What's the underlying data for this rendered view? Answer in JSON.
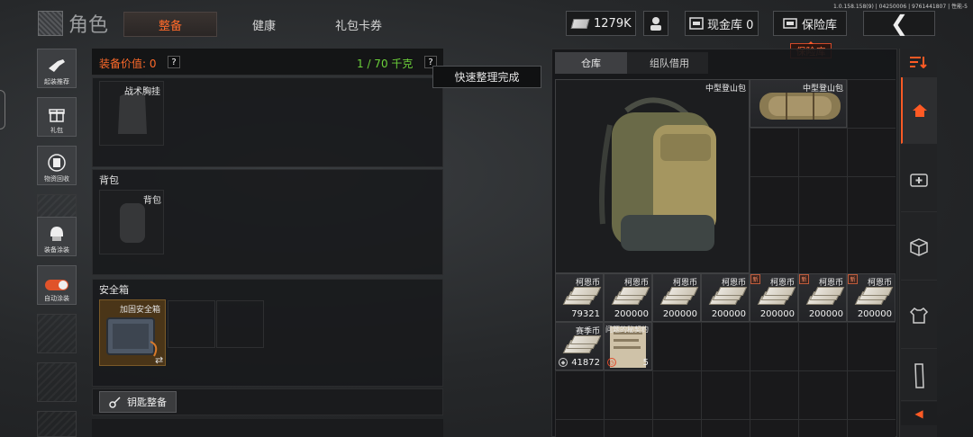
{
  "version": "1.0.158.158(9) | 04250006 | 9761441807 | 性能-5",
  "header": {
    "title": "角色",
    "tabs": [
      {
        "label": "整备",
        "active": true
      },
      {
        "label": "健康"
      },
      {
        "label": "礼包卡券"
      }
    ],
    "money": "1279K",
    "cash_vault": "现金库 0",
    "vault_label": "保险库",
    "vault_tooltip": "保险库",
    "back_icon": "chevron-left-icon"
  },
  "sidebar": {
    "items": [
      {
        "label": "起装推荐",
        "icon": "rifle-icon"
      },
      {
        "label": "礼包",
        "icon": "gift-icon"
      },
      {
        "label": "物资回收",
        "icon": "recycle-icon"
      },
      {
        "label": "装备涂装",
        "icon": "helmet-icon"
      },
      {
        "label": "自动涂装",
        "icon": "toggle-icon",
        "toggle_on": true
      }
    ]
  },
  "equipment": {
    "value_label": "装备价值: 0",
    "weight_label": "1 / 70 千克",
    "help": "?",
    "vest": {
      "slot_label": "战术胸挂"
    },
    "backpack": {
      "section_title": "背包",
      "slot_label": "背包"
    },
    "safe_box": {
      "section_title": "安全箱",
      "item_label": "加固安全箱",
      "swap_icon": "⇄"
    },
    "key_button": "钥匙整备"
  },
  "toast": "快速整理完成",
  "stash": {
    "tabs": [
      {
        "label": "仓库",
        "active": true
      },
      {
        "label": "组队借用"
      }
    ],
    "items": [
      {
        "name": "中型登山包",
        "qty": ""
      },
      {
        "name": "中型登山包",
        "qty": ""
      },
      {
        "name": "柯恩币",
        "qty": "79321",
        "new": false
      },
      {
        "name": "柯恩币",
        "qty": "200000",
        "new": false
      },
      {
        "name": "柯恩币",
        "qty": "200000",
        "new": false
      },
      {
        "name": "柯恩币",
        "qty": "200000",
        "new": false
      },
      {
        "name": "柯恩币",
        "qty": "200000",
        "new": true
      },
      {
        "name": "柯恩币",
        "qty": "200000",
        "new": true
      },
      {
        "name": "柯恩币",
        "qty": "200000",
        "new": true
      },
      {
        "name": "赛季币",
        "qty": "41872"
      },
      {
        "name": "问题的秘契约",
        "qty": "5"
      }
    ],
    "new_badge": "新"
  },
  "rail": {
    "items": [
      "sort-icon",
      "home-icon",
      "medkit-icon",
      "box-icon",
      "armor-icon",
      "magazine-icon",
      "collapse-icon"
    ]
  },
  "colors": {
    "accent": "#ff5a24",
    "weight_green": "#6cd13a"
  }
}
